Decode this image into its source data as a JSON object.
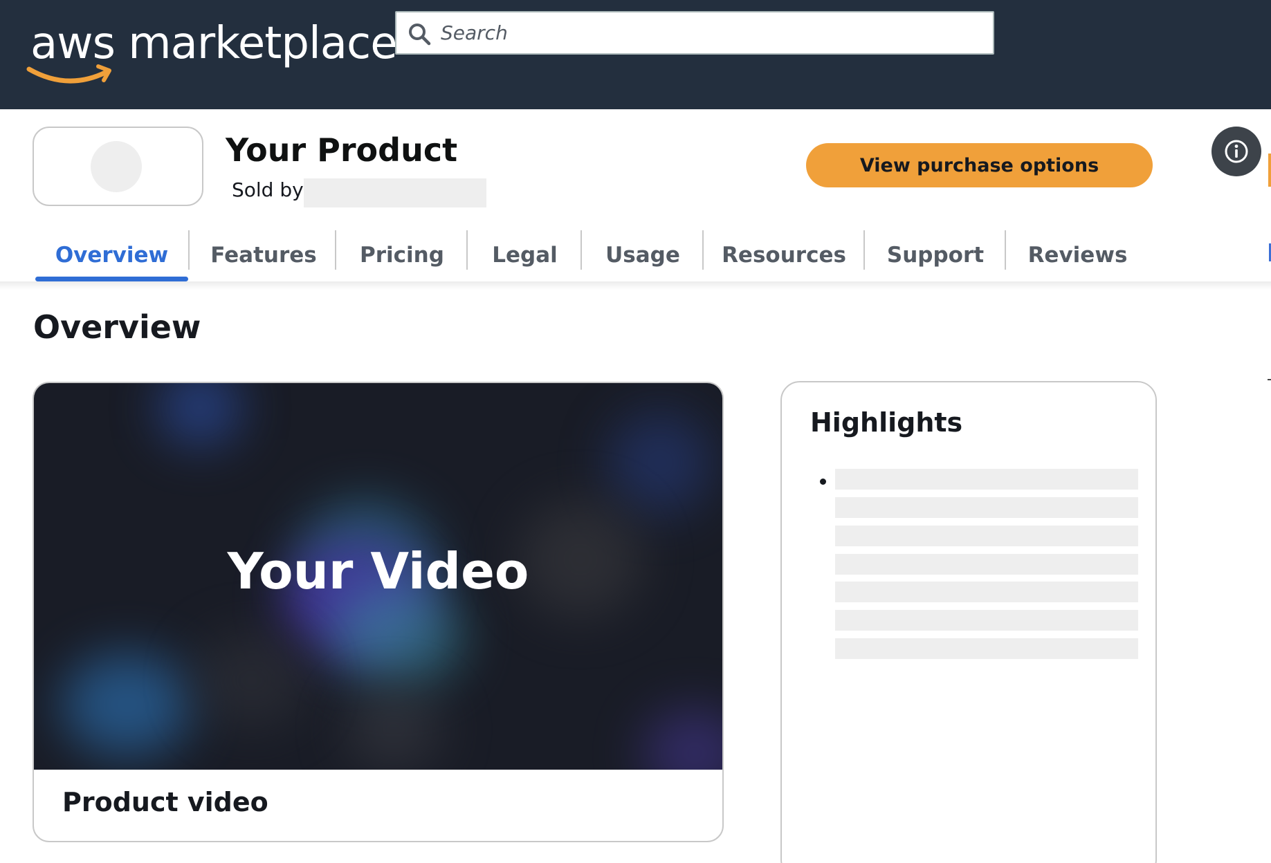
{
  "header": {
    "logo_text": "aws marketplace",
    "search": {
      "placeholder": "Search",
      "value": ""
    }
  },
  "product": {
    "title": "Your Product",
    "sold_by_label": "Sold by:",
    "purchase_button": "View purchase options"
  },
  "tabs": [
    {
      "label": "Overview",
      "active": true
    },
    {
      "label": "Features",
      "active": false
    },
    {
      "label": "Pricing",
      "active": false
    },
    {
      "label": "Legal",
      "active": false
    },
    {
      "label": "Usage",
      "active": false
    },
    {
      "label": "Resources",
      "active": false
    },
    {
      "label": "Support",
      "active": false
    },
    {
      "label": "Reviews",
      "active": false
    }
  ],
  "overview": {
    "title": "Overview",
    "video": {
      "title": "Your Video",
      "caption": "Product video"
    },
    "highlights": {
      "title": "Highlights"
    }
  },
  "colors": {
    "header_bg": "#232f3e",
    "accent_orange": "#f0a03a",
    "tab_active": "#2f6dd5",
    "placeholder_gray": "#eeeeee"
  },
  "icons": [
    "search-icon",
    "info-icon",
    "aws-smile-icon"
  ]
}
